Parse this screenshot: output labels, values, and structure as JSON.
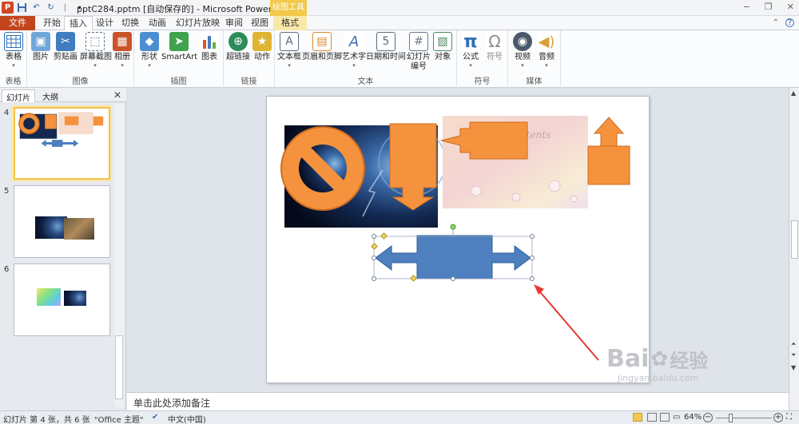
{
  "titlebar": {
    "title": "pptC284.pptm [自动保存的] - Microsoft PowerPoint",
    "context_tool_title": "绘图工具",
    "qat_separator": "|",
    "window_controls": {
      "minimize": "−",
      "restore": "❐",
      "close": "✕"
    }
  },
  "tabs": {
    "file": "文件",
    "items": [
      "开始",
      "插入",
      "设计",
      "切换",
      "动画",
      "幻灯片放映",
      "审阅",
      "视图",
      "格式"
    ],
    "active": "插入",
    "right_icons": {
      "collapse": "⌃",
      "help": "?"
    }
  },
  "ribbon": {
    "groups": [
      {
        "label": "表格",
        "buttons": [
          {
            "label": "表格",
            "icon": "table-icon",
            "color": "#2f6fb5",
            "dropdown": true
          }
        ]
      },
      {
        "label": "图像",
        "buttons": [
          {
            "label": "图片",
            "icon": "picture-icon",
            "color": "#4a87c5",
            "dropdown": false
          },
          {
            "label": "剪贴画",
            "icon": "clipart-icon",
            "color": "#3f7cc0",
            "dropdown": false
          },
          {
            "label": "屏幕截图",
            "icon": "screenshot-icon",
            "color": "#5c6c7f",
            "dropdown": true
          },
          {
            "label": "相册",
            "icon": "album-icon",
            "color": "#c9532a",
            "dropdown": true
          }
        ]
      },
      {
        "label": "插图",
        "buttons": [
          {
            "label": "形状",
            "icon": "shapes-icon",
            "color": "#4b8fd1",
            "dropdown": true
          },
          {
            "label": "SmartArt",
            "icon": "smartart-icon",
            "color": "#3fa34d",
            "dropdown": false
          },
          {
            "label": "图表",
            "icon": "chart-icon",
            "color": "#d45a2a",
            "dropdown": false
          }
        ]
      },
      {
        "label": "链接",
        "buttons": [
          {
            "label": "超链接",
            "icon": "hyperlink-icon",
            "color": "#2d8c5a",
            "dropdown": false
          },
          {
            "label": "动作",
            "icon": "action-icon",
            "color": "#e0b433",
            "dropdown": false
          }
        ]
      },
      {
        "label": "文本",
        "buttons": [
          {
            "label": "文本框",
            "icon": "textbox-icon",
            "color": "#5a6f8a",
            "dropdown": true
          },
          {
            "label": "页眉和页脚",
            "icon": "header-footer-icon",
            "color": "#d98b2b",
            "dropdown": false
          },
          {
            "label": "艺术字",
            "icon": "wordart-icon",
            "color": "#3d6fb0",
            "dropdown": true
          },
          {
            "label": "日期和时间",
            "icon": "datetime-icon",
            "color": "#5b6b7c",
            "dropdown": false
          },
          {
            "label": "幻灯片编号",
            "icon": "slide-number-icon",
            "color": "#6b7a8c",
            "dropdown": false
          },
          {
            "label": "对象",
            "icon": "object-icon",
            "color": "#4e8a5c",
            "dropdown": false
          }
        ]
      },
      {
        "label": "符号",
        "buttons": [
          {
            "label": "公式",
            "icon": "equation-icon",
            "color": "#2f6fb5",
            "dropdown": true
          },
          {
            "label": "符号",
            "icon": "symbol-icon",
            "color": "#8a8f97",
            "dropdown": false
          }
        ]
      },
      {
        "label": "媒体",
        "buttons": [
          {
            "label": "视频",
            "icon": "video-icon",
            "color": "#4b5a6b",
            "dropdown": true
          },
          {
            "label": "音频",
            "icon": "audio-icon",
            "color": "#d9a03a",
            "dropdown": true
          }
        ]
      }
    ]
  },
  "panel": {
    "tabs": [
      "幻灯片",
      "大纲"
    ],
    "active_tab": "幻灯片",
    "close": "✕",
    "slides": [
      {
        "number": "4",
        "selected": true
      },
      {
        "number": "5",
        "selected": false
      },
      {
        "number": "6",
        "selected": false
      }
    ]
  },
  "slide": {
    "image_caption": "Asadal Contents",
    "shape_color": "#f4923d",
    "shape_outline": "#d06b1f",
    "selected_shape_color": "#4e7fbf",
    "selected_shape_outline": "#2f5f99",
    "annotation_color": "#e53935"
  },
  "notes": {
    "placeholder": "单击此处添加备注"
  },
  "status": {
    "slide_info": "幻灯片 第 4 张，共 6 张",
    "theme": "\"Office 主题\"",
    "language": "中文(中国)",
    "zoom": "64%",
    "zoom_minus": "−",
    "zoom_plus": "+"
  },
  "watermark": {
    "brand": "Bai",
    "brand_cn": "经验",
    "url": "jingyan.baidu.com"
  }
}
